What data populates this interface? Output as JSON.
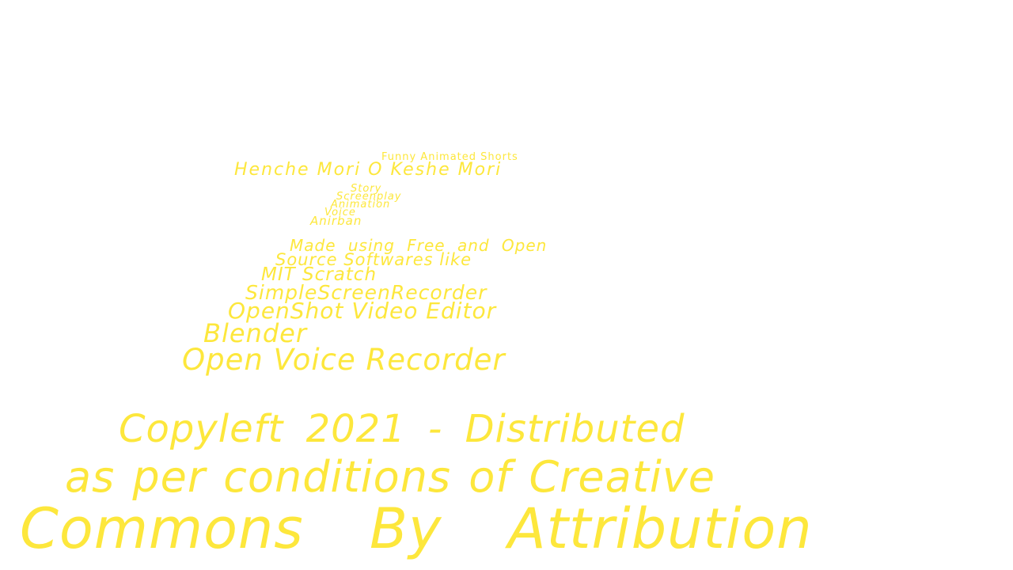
{
  "colors": {
    "background": "#ffffff",
    "text": "#fde73c"
  },
  "credits": {
    "series": "Funny Animated Shorts",
    "title": "Henche Mori O Keshe Mori",
    "roles": [
      "Story",
      "Screenplay",
      "Animation",
      "Voice"
    ],
    "author": "Anirban",
    "made_with_line1": "Made using Free and Open",
    "made_with_line2": "Source Softwares like",
    "software": [
      "MIT Scratch",
      "SimpleScreenRecorder",
      "OpenShot Video Editor",
      "Blender",
      "Open Voice Recorder"
    ],
    "copyleft_line1": "Copyleft 2021 - Distributed",
    "copyleft_line2": "as per conditions of Creative",
    "copyleft_line3": "Commons By Attribution"
  }
}
